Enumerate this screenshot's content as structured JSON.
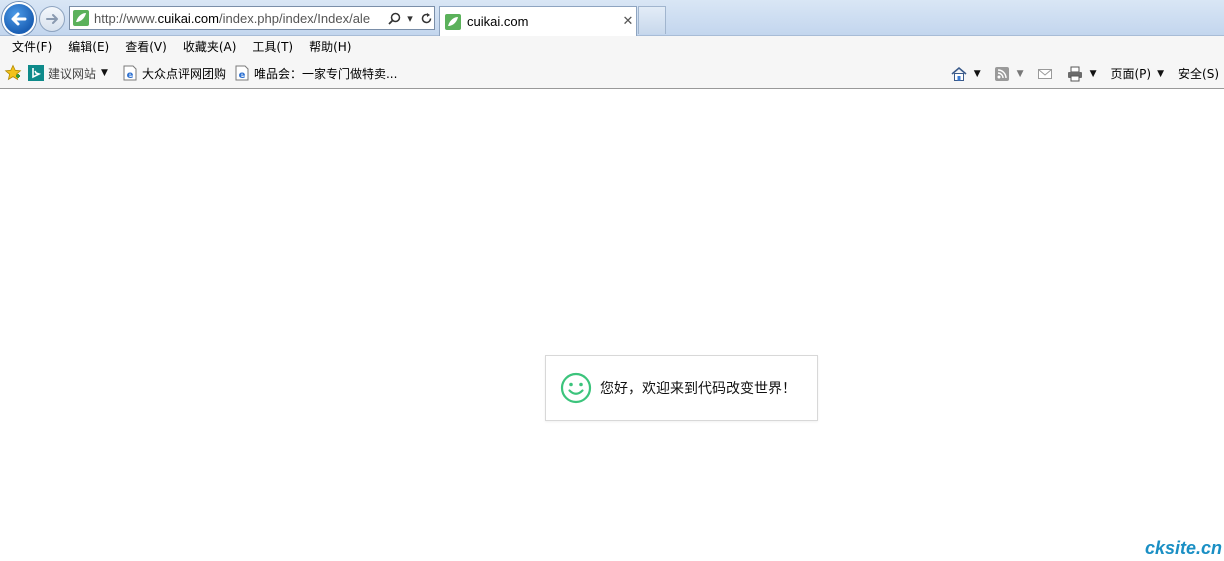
{
  "browser": {
    "address": {
      "url_prefix": "http://www.",
      "url_domain": "cuikai.com",
      "url_rest": "/index.php/index/Index/ale"
    },
    "active_tab": {
      "title": "cuikai.com"
    }
  },
  "menu": {
    "items": [
      "文件(F)",
      "编辑(E)",
      "查看(V)",
      "收藏夹(A)",
      "工具(T)",
      "帮助(H)"
    ]
  },
  "favorites": {
    "suggested_sites": "建议网站",
    "items": [
      "大众点评网团购",
      "唯品会：一家专门做特卖..."
    ]
  },
  "command_bar": {
    "page": "页面(P)",
    "safety": "安全(S)"
  },
  "alert": {
    "message": "您好，欢迎来到代码改变世界！",
    "icon": "smiley-face-icon",
    "icon_color": "#3cc47c"
  },
  "watermark": {
    "text": "cksite.cn",
    "color": "#1a8fc4"
  }
}
